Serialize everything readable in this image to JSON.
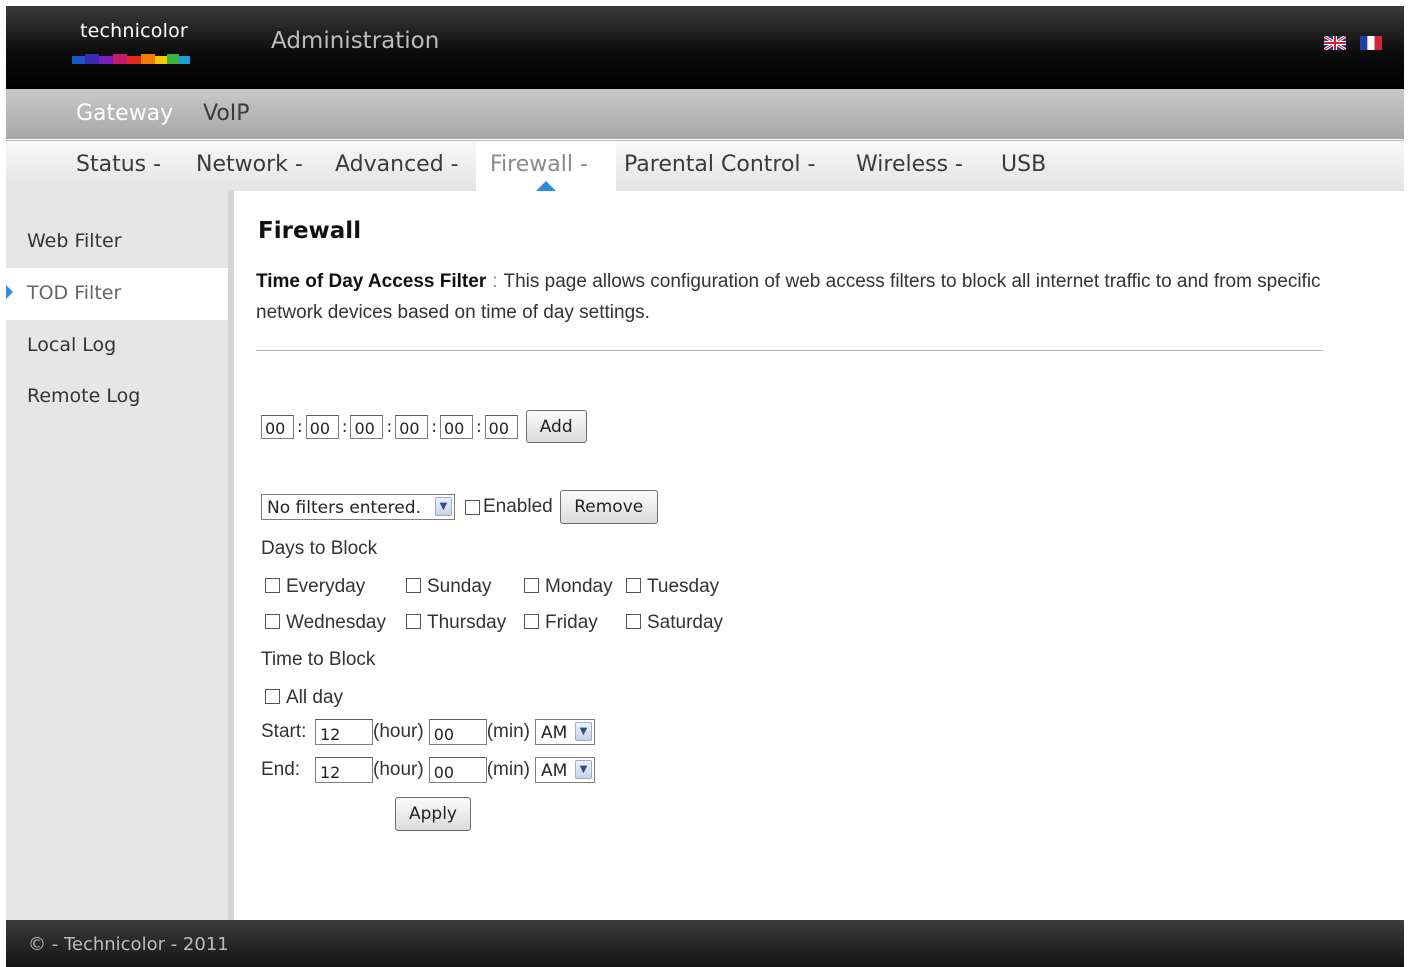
{
  "header": {
    "logo_text": "technicolor",
    "title": "Administration",
    "flags": [
      "uk-flag-icon",
      "france-flag-icon"
    ]
  },
  "primary_nav": {
    "items": [
      {
        "label": "Gateway",
        "active": true
      },
      {
        "label": "VoIP",
        "active": false
      }
    ]
  },
  "secondary_nav": {
    "items": [
      {
        "label": "Status -"
      },
      {
        "label": "Network -"
      },
      {
        "label": "Advanced -"
      },
      {
        "label": "Firewall -",
        "selected": true
      },
      {
        "label": "Parental Control -"
      },
      {
        "label": "Wireless -"
      },
      {
        "label": "USB"
      }
    ]
  },
  "sidebar": {
    "items": [
      {
        "label": "Web Filter",
        "selected": false
      },
      {
        "label": "TOD Filter",
        "selected": true
      },
      {
        "label": "Local Log",
        "selected": false
      },
      {
        "label": "Remote Log",
        "selected": false
      }
    ]
  },
  "main": {
    "title": "Firewall",
    "description_label": "Time of Day Access Filter",
    "description_sep": ":",
    "description_text": "This page allows configuration of web access filters to block all internet traffic to and from specific network devices based on time of day settings.",
    "mac_fields": [
      "00",
      "00",
      "00",
      "00",
      "00",
      "00"
    ],
    "mac_separator": ":",
    "add_label": "Add",
    "filter_select_value": "No filters entered.",
    "enabled_label": "Enabled",
    "remove_label": "Remove",
    "days_heading": "Days to Block",
    "days": [
      "Everyday",
      "Sunday",
      "Monday",
      "Tuesday",
      "Wednesday",
      "Thursday",
      "Friday",
      "Saturday"
    ],
    "time_heading": "Time to Block",
    "all_day_label": "All day",
    "start_label": "Start:",
    "end_label": "End:",
    "hour_unit": "(hour)",
    "min_unit": "(min)",
    "start_hour": "12",
    "start_min": "00",
    "start_ampm": "AM",
    "end_hour": "12",
    "end_min": "00",
    "end_ampm": "AM",
    "apply_label": "Apply"
  },
  "footer": {
    "text": "© - Technicolor - 2011"
  },
  "colors": {
    "accent": "#2a8fd8",
    "header_bg": "#0d0d0d",
    "sidebar_bg": "#e6e6e6"
  }
}
